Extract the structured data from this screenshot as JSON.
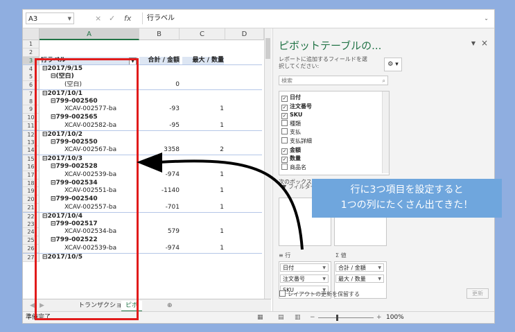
{
  "formula_bar": {
    "name_box": "A3",
    "fx_label": "fx",
    "cancel_glyph": "×",
    "enter_glyph": "✓",
    "content": "行ラベル"
  },
  "columns": [
    "A",
    "B",
    "C",
    "D"
  ],
  "rows": [
    {
      "n": "1",
      "a": "",
      "b": "",
      "c": "",
      "kind": "blank"
    },
    {
      "n": "2",
      "a": "",
      "b": "",
      "c": "",
      "kind": "blank"
    },
    {
      "n": "3",
      "a": "行ラベル",
      "b": "合計 / 金額",
      "c": "最大 / 数量",
      "kind": "header"
    },
    {
      "n": "4",
      "a": "⊟2017/9/15",
      "b": "",
      "c": "",
      "kind": "date"
    },
    {
      "n": "5",
      "a": "⊟(空白)",
      "b": "",
      "c": "",
      "kind": "sku"
    },
    {
      "n": "6",
      "a": "(空白)",
      "b": "0",
      "c": "",
      "kind": "item"
    },
    {
      "n": "7",
      "a": "⊟2017/10/1",
      "b": "",
      "c": "",
      "kind": "date"
    },
    {
      "n": "8",
      "a": "⊟799-002560",
      "b": "",
      "c": "",
      "kind": "sku"
    },
    {
      "n": "9",
      "a": "XCAV-002577-ba",
      "b": "-93",
      "c": "1",
      "kind": "item"
    },
    {
      "n": "10",
      "a": "⊟799-002565",
      "b": "",
      "c": "",
      "kind": "sku"
    },
    {
      "n": "11",
      "a": "XCAV-002582-ba",
      "b": "-95",
      "c": "1",
      "kind": "item"
    },
    {
      "n": "12",
      "a": "⊟2017/10/2",
      "b": "",
      "c": "",
      "kind": "date"
    },
    {
      "n": "13",
      "a": "⊟799-002550",
      "b": "",
      "c": "",
      "kind": "sku"
    },
    {
      "n": "14",
      "a": "XCAV-002567-ba",
      "b": "3358",
      "c": "2",
      "kind": "item"
    },
    {
      "n": "15",
      "a": "⊟2017/10/3",
      "b": "",
      "c": "",
      "kind": "date"
    },
    {
      "n": "16",
      "a": "⊟799-002528",
      "b": "",
      "c": "",
      "kind": "sku"
    },
    {
      "n": "17",
      "a": "XCAV-002539-ba",
      "b": "-974",
      "c": "1",
      "kind": "item"
    },
    {
      "n": "18",
      "a": "⊟799-002534",
      "b": "",
      "c": "",
      "kind": "sku"
    },
    {
      "n": "19",
      "a": "XCAV-002551-ba",
      "b": "-1140",
      "c": "1",
      "kind": "item"
    },
    {
      "n": "20",
      "a": "⊟799-002540",
      "b": "",
      "c": "",
      "kind": "sku"
    },
    {
      "n": "21",
      "a": "XCAV-002557-ba",
      "b": "-701",
      "c": "1",
      "kind": "item"
    },
    {
      "n": "22",
      "a": "⊟2017/10/4",
      "b": "",
      "c": "",
      "kind": "date"
    },
    {
      "n": "23",
      "a": "⊟799-002517",
      "b": "",
      "c": "",
      "kind": "sku"
    },
    {
      "n": "24",
      "a": "XCAV-002534-ba",
      "b": "579",
      "c": "1",
      "kind": "item"
    },
    {
      "n": "25",
      "a": "⊟799-002522",
      "b": "",
      "c": "",
      "kind": "sku"
    },
    {
      "n": "26",
      "a": "XCAV-002539-ba",
      "b": "-974",
      "c": "1",
      "kind": "item"
    },
    {
      "n": "27",
      "a": "⊟2017/10/5",
      "b": "",
      "c": "",
      "kind": "date"
    }
  ],
  "sheet_tabs": {
    "tab1": "トランザクション",
    "tab2": "ピボ",
    "add": "⊕"
  },
  "status": {
    "ready": "準備完了",
    "zoom": "100%"
  },
  "pivot": {
    "title": "ピボットテーブルの...",
    "description": "レポートに追加するフィールドを選択してください:",
    "search_placeholder": "検索",
    "fields": [
      {
        "label": "日付",
        "checked": true
      },
      {
        "label": "注文番号",
        "checked": true
      },
      {
        "label": "SKU",
        "checked": true
      },
      {
        "label": "種類",
        "checked": false
      },
      {
        "label": "支払",
        "checked": false
      },
      {
        "label": "支払詳細",
        "checked": false
      },
      {
        "label": "金額",
        "checked": true
      },
      {
        "label": "数量",
        "checked": true
      },
      {
        "label": "商品名",
        "checked": false
      }
    ],
    "areas_label": "次のボックス間",
    "filter_label": "フィルター",
    "rows_label": "行",
    "values_label": "値",
    "row_fields": [
      "日付",
      "注文番号",
      "SKU"
    ],
    "value_fields": [
      "合計 / 金額",
      "最大 / 数量"
    ],
    "defer_label": "レイアウトの更新を保留する",
    "update_button": "更新"
  },
  "annotation": {
    "line1": "行に3つ項目を設定すると",
    "line2": "1つの列にたくさん出てきた！",
    "box_color": "#e11b1b",
    "callout_color": "#6fa6dd"
  }
}
